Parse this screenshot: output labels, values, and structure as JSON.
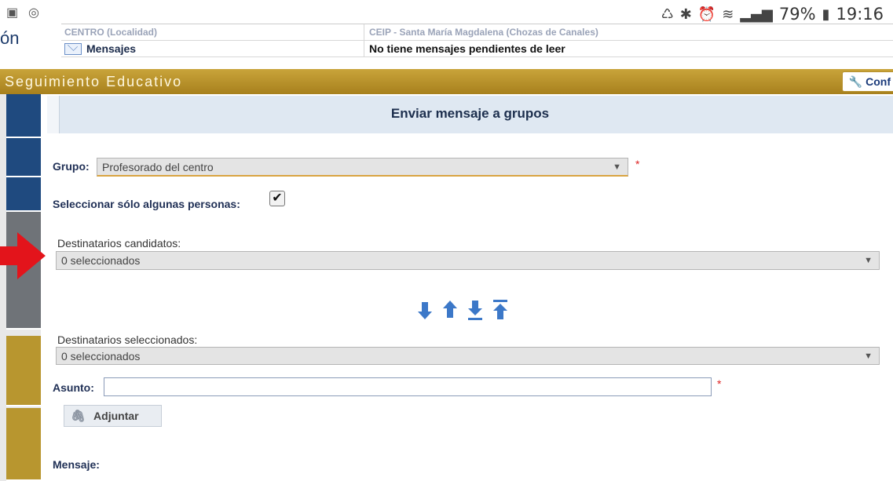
{
  "status_bar": {
    "battery": "79%",
    "time": "19:16"
  },
  "header_info": {
    "brand_fragment": "ón",
    "rows": [
      {
        "label": "CENTRO (Localidad)",
        "value": "CEIP - Santa María Magdalena (Chozas de Canales)"
      },
      {
        "label": "Mensajes",
        "value": "No tiene mensajes pendientes de leer"
      }
    ]
  },
  "top_bar": {
    "title": "Seguimiento Educativo",
    "config_label": "Conf"
  },
  "panel": {
    "title": "Enviar mensaje a grupos"
  },
  "form": {
    "group_label": "Grupo:",
    "group_value": "Profesorado del centro",
    "required_mark": "*",
    "select_some_label": "Seleccionar sólo algunas personas:",
    "select_some_checked": true,
    "candidates_label": "Destinatarios candidatos:",
    "candidates_value": "0 seleccionados",
    "selected_label": "Destinatarios seleccionados:",
    "selected_value": "0 seleccionados",
    "subject_label": "Asunto:",
    "subject_value": "",
    "attach_label": "Adjuntar",
    "message_label": "Mensaje:"
  },
  "colors": {
    "gold_bar": "#b8922a",
    "sidebar_blue": "#1f4a7f",
    "arrow_red": "#e3141b",
    "move_arrow_blue": "#3c78c8"
  }
}
